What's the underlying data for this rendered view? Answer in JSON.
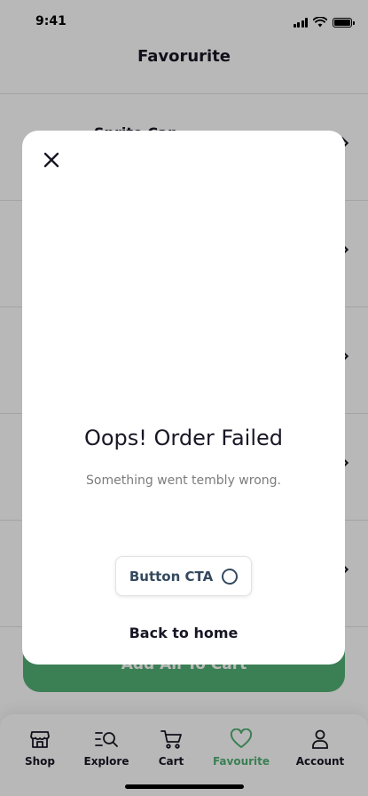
{
  "status_bar": {
    "time": "9:41"
  },
  "header": {
    "title": "Favorurite"
  },
  "favourites": [
    {
      "name": "Sprite Can"
    },
    {
      "name": ""
    },
    {
      "name": ""
    },
    {
      "name": ""
    },
    {
      "name": ""
    }
  ],
  "add_all_button": {
    "label": "Add All To Cart"
  },
  "modal": {
    "title": "Oops! Order Failed",
    "subtitle": "Something went tembly wrong.",
    "cta_label": "Button CTA",
    "back_link": "Back to home"
  },
  "nav": {
    "items": [
      {
        "label": "Shop",
        "icon": "shop-icon"
      },
      {
        "label": "Explore",
        "icon": "explore-icon"
      },
      {
        "label": "Cart",
        "icon": "cart-icon"
      },
      {
        "label": "Favourite",
        "icon": "heart-icon"
      },
      {
        "label": "Account",
        "icon": "account-icon"
      }
    ],
    "active": "Favourite"
  },
  "colors": {
    "accent": "#53b175",
    "text": "#181725",
    "muted": "#7c7c7c",
    "divider": "#e2e2e2",
    "cta_text": "#34495e"
  }
}
